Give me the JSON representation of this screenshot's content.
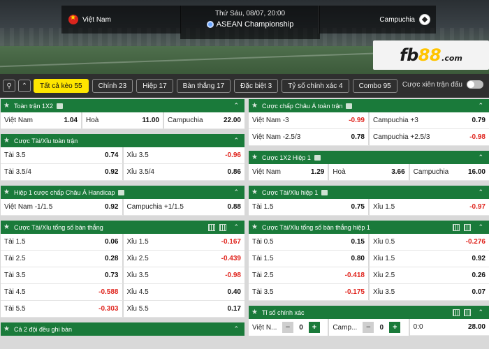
{
  "match": {
    "home": "Việt Nam",
    "away": "Campuchia",
    "datetime": "Thứ Sáu, 08/07, 20:00",
    "league": "ASEAN Championship"
  },
  "brand": {
    "pre": "fb",
    "num": "88",
    "suffix": ".com"
  },
  "tabs": [
    {
      "label": "Tất cả kèo  55",
      "active": true
    },
    {
      "label": "Chính  23"
    },
    {
      "label": "Hiệp  17"
    },
    {
      "label": "Bàn thắng  17"
    },
    {
      "label": "Đặc biệt  3"
    },
    {
      "label": "Tỷ số chính xác  4"
    },
    {
      "label": "Combo  95"
    }
  ],
  "parlay_label": "Cược xiên trận đấu",
  "panels": {
    "p1": {
      "title": "Toàn trận 1X2",
      "rows": [
        [
          [
            "Việt Nam",
            "1.04"
          ],
          [
            "Hoà",
            "11.00"
          ],
          [
            "Campuchia",
            "22.00"
          ]
        ]
      ]
    },
    "p2": {
      "title": "Cược Tài/Xỉu toàn trận",
      "rows": [
        [
          [
            "Tài 3.5",
            "0.74"
          ],
          [
            "Xỉu 3.5",
            "-0.96"
          ]
        ],
        [
          [
            "Tài 3.5/4",
            "0.92"
          ],
          [
            "Xỉu 3.5/4",
            "0.86"
          ]
        ]
      ]
    },
    "p3": {
      "title": "Hiệp 1 cược chấp Châu Á Handicap",
      "rows": [
        [
          [
            "Việt Nam -1/1.5",
            "0.92"
          ],
          [
            "Campuchia +1/1.5",
            "0.88"
          ]
        ]
      ]
    },
    "p4": {
      "title": "Cược Tài/Xỉu tổng số bàn thắng",
      "rows": [
        [
          [
            "Tài 1.5",
            "0.06"
          ],
          [
            "Xỉu 1.5",
            "-0.167"
          ]
        ],
        [
          [
            "Tài 2.5",
            "0.28"
          ],
          [
            "Xỉu 2.5",
            "-0.439"
          ]
        ],
        [
          [
            "Tài 3.5",
            "0.73"
          ],
          [
            "Xỉu 3.5",
            "-0.98"
          ]
        ],
        [
          [
            "Tài 4.5",
            "-0.588"
          ],
          [
            "Xỉu 4.5",
            "0.40"
          ]
        ],
        [
          [
            "Tài 5.5",
            "-0.303"
          ],
          [
            "Xỉu 5.5",
            "0.17"
          ]
        ]
      ]
    },
    "p5": {
      "title": "Cả 2 đội đều ghi bàn"
    },
    "p6": {
      "title": "Cược chấp Châu Á toàn trận",
      "rows": [
        [
          [
            "Việt Nam -3",
            "-0.99"
          ],
          [
            "Campuchia +3",
            "0.79"
          ]
        ],
        [
          [
            "Việt Nam -2.5/3",
            "0.78"
          ],
          [
            "Campuchia +2.5/3",
            "-0.98"
          ]
        ]
      ]
    },
    "p7": {
      "title": "Cược 1X2 Hiệp 1",
      "rows": [
        [
          [
            "Việt Nam",
            "1.29"
          ],
          [
            "Hoà",
            "3.66"
          ],
          [
            "Campuchia",
            "16.00"
          ]
        ]
      ]
    },
    "p8": {
      "title": "Cược Tài/Xỉu hiệp 1",
      "rows": [
        [
          [
            "Tài 1.5",
            "0.75"
          ],
          [
            "Xỉu 1.5",
            "-0.97"
          ]
        ]
      ]
    },
    "p9": {
      "title": "Cược Tài/Xỉu tổng số bàn thắng hiệp 1",
      "rows": [
        [
          [
            "Tài 0.5",
            "0.15"
          ],
          [
            "Xỉu 0.5",
            "-0.276"
          ]
        ],
        [
          [
            "Tài 1.5",
            "0.80"
          ],
          [
            "Xỉu 1.5",
            "0.92"
          ]
        ],
        [
          [
            "Tài 2.5",
            "-0.418"
          ],
          [
            "Xỉu 2.5",
            "0.26"
          ]
        ],
        [
          [
            "Tài 3.5",
            "-0.175"
          ],
          [
            "Xỉu 3.5",
            "0.07"
          ]
        ]
      ]
    },
    "p10": {
      "title": "Tỉ số chính xác",
      "home_short": "Việt N...",
      "away_short": "Camp...",
      "home_score": "0",
      "away_score": "0",
      "result_label": "0:0",
      "result_odd": "28.00"
    }
  }
}
